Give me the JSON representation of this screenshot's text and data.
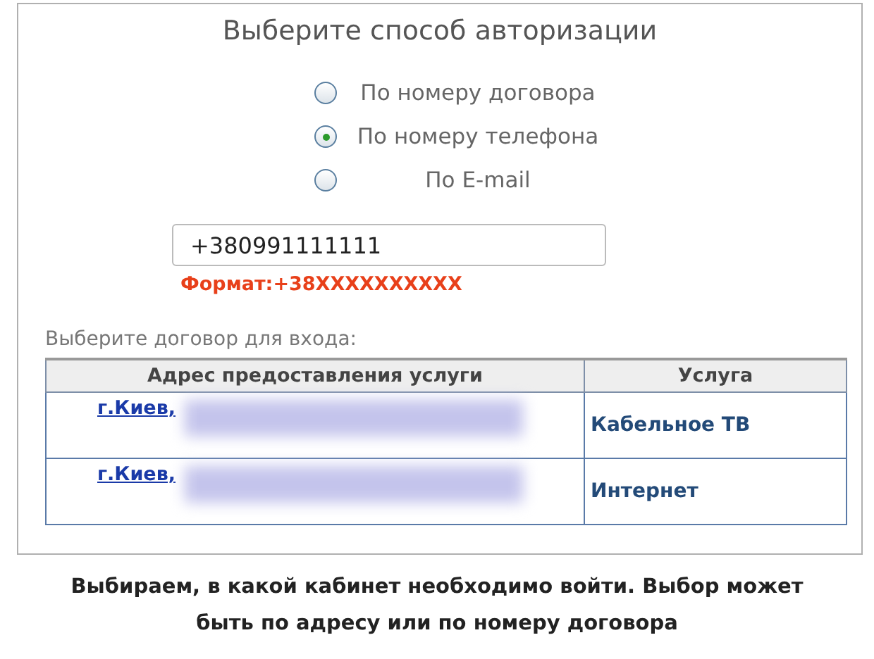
{
  "title": "Выберите способ авторизации",
  "auth_options": [
    {
      "label": "По номеру договора",
      "selected": false
    },
    {
      "label": "По номеру телефона",
      "selected": true
    },
    {
      "label": "По E-mail",
      "selected": false
    }
  ],
  "phone_field": {
    "value": "+380991111111"
  },
  "format_hint": "Формат:+38XXXXXXXXXX",
  "contract_prompt": "Выберите договор для входа:",
  "table": {
    "columns": [
      "Адрес предоставления услуги",
      "Услуга"
    ],
    "rows": [
      {
        "address": "г.Киев,",
        "service": "Кабельное ТВ"
      },
      {
        "address": "г.Киев,",
        "service": "Интернет"
      }
    ]
  },
  "caption": "Выбираем, в какой кабинет необходимо войти. Выбор может быть по адресу или по номеру договора"
}
